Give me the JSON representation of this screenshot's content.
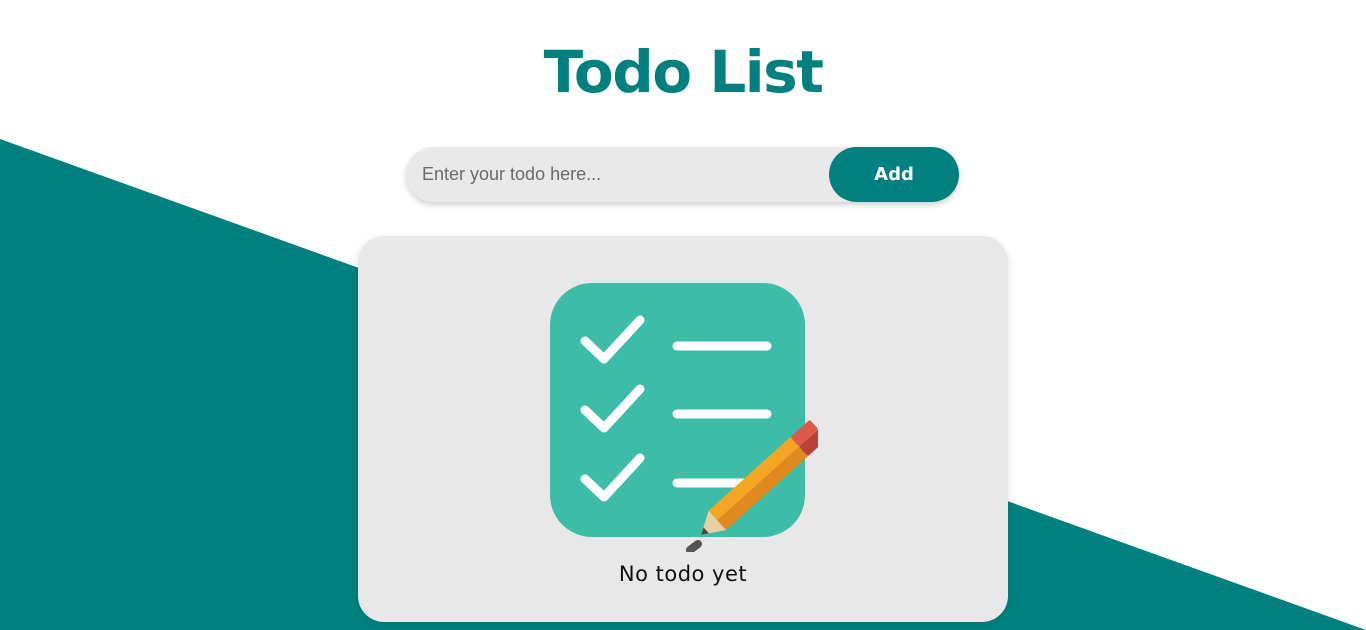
{
  "app": {
    "title": "Todo List"
  },
  "todo_form": {
    "input_value": "",
    "input_placeholder": "Enter your todo here...",
    "add_label": "Add"
  },
  "todo_list": {
    "items": [],
    "empty_text": "No todo yet",
    "empty_icon": "checklist-pencil-icon"
  },
  "colors": {
    "brand_teal": "#00817f",
    "icon_teal": "#3dbca8",
    "card_bg": "#e8e8e8",
    "input_bg": "#e9e9e9",
    "page_bg": "#ffffff"
  }
}
